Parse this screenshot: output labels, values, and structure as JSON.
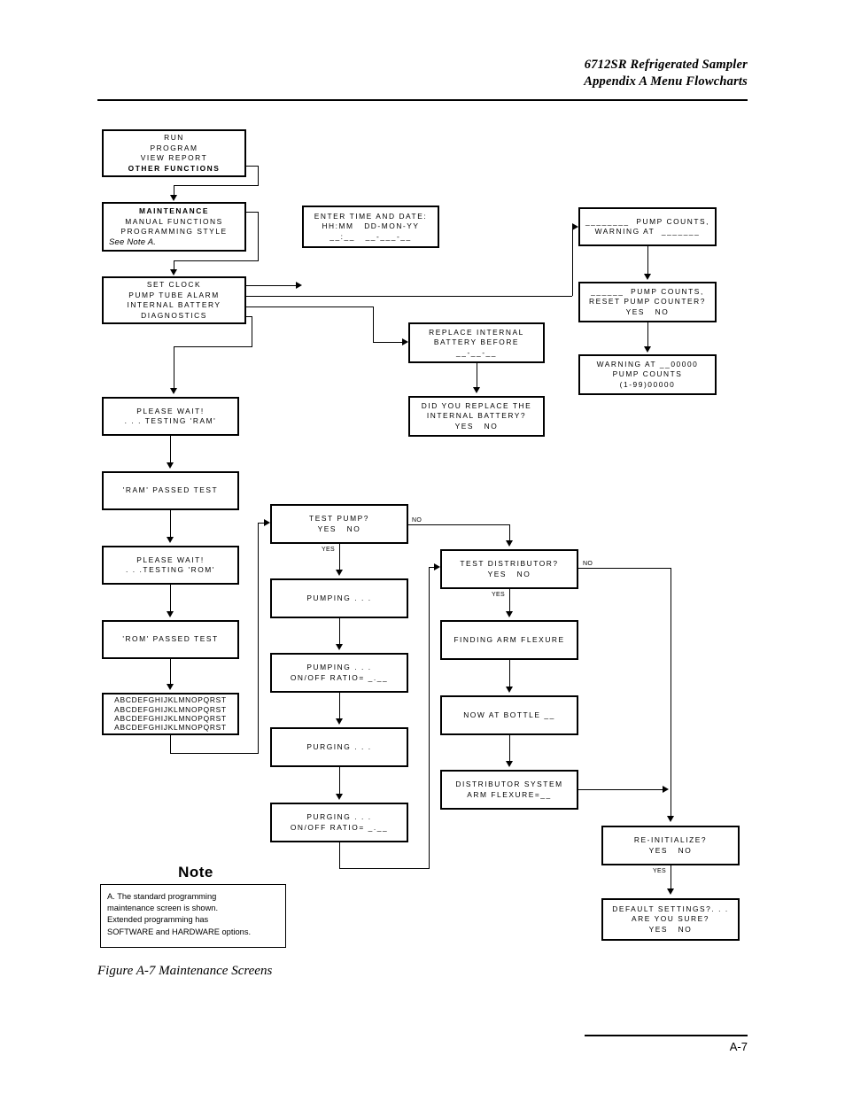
{
  "header": {
    "line1": "6712SR Refrigerated Sampler",
    "line2": "Appendix A  Menu Flowcharts"
  },
  "footer": {
    "page_number": "A-7"
  },
  "caption": "Figure A-7  Maintenance Screens",
  "note": {
    "title": "Note",
    "lines": [
      "A. The standard programming",
      "maintenance screen is shown.",
      "Extended programming has",
      "SOFTWARE and HARDWARE options."
    ]
  },
  "branch_labels": {
    "yes": "YES",
    "no": "NO"
  },
  "boxes": {
    "main_menu": {
      "lines": [
        "RUN",
        "PROGRAM",
        "VIEW REPORT",
        "OTHER FUNCTIONS"
      ],
      "bold_index": 3
    },
    "maintenance_menu": {
      "lines": [
        "MAINTENANCE",
        "MANUAL FUNCTIONS",
        "PROGRAMMING STYLE",
        "See Note A."
      ],
      "bold_index": 0,
      "italic_index": 3
    },
    "submenu": {
      "lines": [
        "SET CLOCK",
        "PUMP TUBE ALARM",
        "INTERNAL BATTERY",
        "DIAGNOSTICS"
      ]
    },
    "enter_time_date": {
      "lines": [
        "ENTER TIME AND DATE:",
        "HH:MM   DD-MON-YY",
        "__:__   __-___-__"
      ]
    },
    "pump_counts_warning": {
      "lines": [
        "________  PUMP COUNTS,",
        "WARNING AT  _______"
      ]
    },
    "reset_pump_counter": {
      "lines": [
        "______  PUMP COUNTS,",
        "RESET PUMP COUNTER?",
        "YES   NO"
      ]
    },
    "warning_at_counts": {
      "lines": [
        "WARNING AT __00000",
        "PUMP COUNTS",
        "(1-99)00000"
      ]
    },
    "replace_battery": {
      "lines": [
        "REPLACE INTERNAL",
        "BATTERY BEFORE",
        "__-__-__"
      ]
    },
    "did_you_replace": {
      "lines": [
        "DID YOU REPLACE THE",
        "INTERNAL BATTERY?",
        "YES   NO"
      ]
    },
    "testing_ram": {
      "lines": [
        "PLEASE WAIT!",
        ". . . TESTING 'RAM'"
      ]
    },
    "ram_passed": {
      "lines": [
        "'RAM' PASSED TEST"
      ]
    },
    "testing_rom": {
      "lines": [
        "PLEASE WAIT!",
        ". . .TESTING 'ROM'"
      ]
    },
    "rom_passed": {
      "lines": [
        "'ROM' PASSED TEST"
      ]
    },
    "alphabet_test": {
      "lines": [
        "ABCDEFGHIJKLMNOPQRST",
        "ABCDEFGHIJKLMNOPQRST",
        "ABCDEFGHIJKLMNOPQRST",
        "ABCDEFGHIJKLMNOPQRST"
      ]
    },
    "test_pump": {
      "lines": [
        "TEST PUMP?",
        "YES   NO"
      ]
    },
    "pumping": {
      "lines": [
        "PUMPING . . ."
      ]
    },
    "pumping_ratio": {
      "lines": [
        "PUMPING . . .",
        "ON/OFF RATIO= _.__"
      ]
    },
    "purging": {
      "lines": [
        "PURGING . . ."
      ]
    },
    "purging_ratio": {
      "lines": [
        "PURGING . . .",
        "ON/OFF RATIO= _.__"
      ]
    },
    "test_distributor": {
      "lines": [
        "TEST DISTRIBUTOR?",
        "YES   NO"
      ]
    },
    "finding_arm_flexure": {
      "lines": [
        "FINDING ARM FLEXURE"
      ]
    },
    "now_at_bottle": {
      "lines": [
        "NOW AT BOTTLE __"
      ]
    },
    "distributor_system": {
      "lines": [
        "DISTRIBUTOR SYSTEM",
        "ARM FLEXURE=__"
      ]
    },
    "re_initialize": {
      "lines": [
        "RE-INITIALIZE?",
        "YES   NO"
      ]
    },
    "default_settings": {
      "lines": [
        "DEFAULT SETTINGS?. . .",
        "ARE YOU SURE?",
        "YES   NO"
      ]
    }
  }
}
